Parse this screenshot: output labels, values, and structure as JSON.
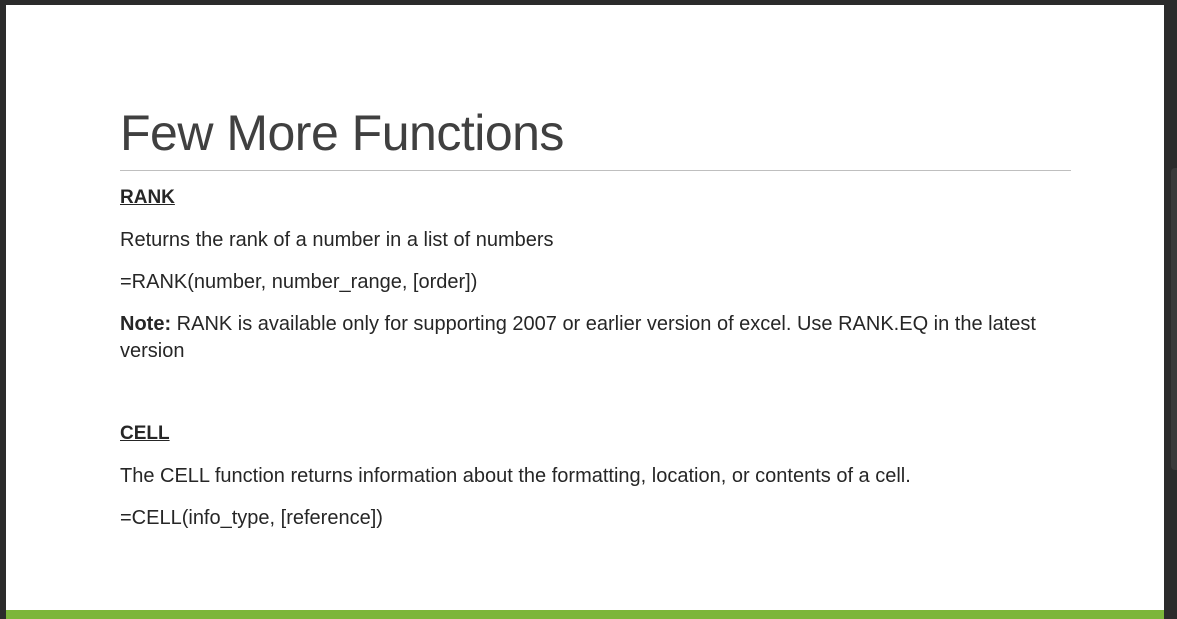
{
  "slide": {
    "title": "Few More Functions",
    "sections": [
      {
        "heading": "RANK",
        "description": "Returns the rank of a number in a list of numbers",
        "syntax": "=RANK(number, number_range, [order])",
        "note_label": "Note:",
        "note_text": " RANK is available only for supporting 2007 or earlier version of excel. Use RANK.EQ in the latest version"
      },
      {
        "heading": "CELL",
        "description": "The CELL function returns information about the formatting, location, or contents of a cell.",
        "syntax": "=CELL(info_type, [reference])"
      }
    ]
  },
  "colors": {
    "accent": "#7cb63a",
    "title_text": "#404040",
    "body_text": "#262626",
    "frame": "#2b2b2b"
  }
}
